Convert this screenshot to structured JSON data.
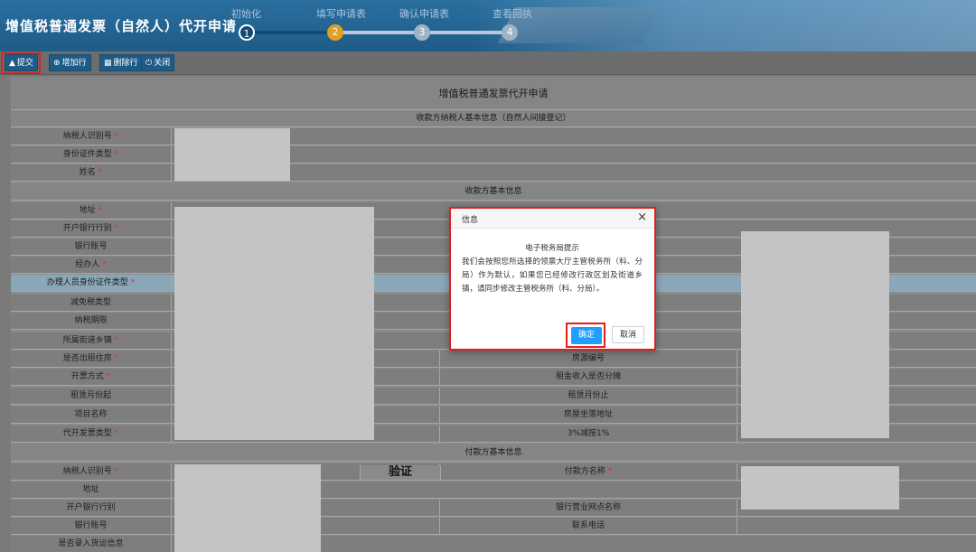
{
  "header": {
    "app_title": "增值税普通发票（自然人）代开申请",
    "steps": [
      {
        "label": "初始化",
        "number": "1"
      },
      {
        "label": "填写申请表",
        "number": "2"
      },
      {
        "label": "确认申请表",
        "number": "3"
      },
      {
        "label": "查看回执",
        "number": "4"
      }
    ],
    "active_step": 2
  },
  "toolbar": {
    "submit": "提交",
    "add_row": "增加行",
    "delete_row": "删除行",
    "close": "关闭"
  },
  "form": {
    "title": "增值税普通发票代开申请",
    "section_payee_taxpayer": "收款方纳税人基本信息（自然人间接登记）",
    "section_payee": "收款方基本信息",
    "section_payer": "付款方基本信息",
    "required_mark": "*",
    "rows": [
      {
        "label": "纳税人识别号",
        "required": true,
        "label2": ""
      },
      {
        "label": "身份证件类型",
        "required": true,
        "label2": ""
      },
      {
        "label": "姓名",
        "required": true,
        "label2": ""
      },
      {
        "label": "地址",
        "required": true,
        "label2": ""
      },
      {
        "label": "开户银行行别",
        "required": true,
        "label2": ""
      },
      {
        "label": "银行账号",
        "required": false,
        "label2": ""
      },
      {
        "label": "经办人",
        "required": true,
        "label2": ""
      },
      {
        "label": "办理人员身份证件类型",
        "required": true,
        "label2": ""
      },
      {
        "label": "减免税类型",
        "required": false,
        "label2": ""
      },
      {
        "label": "纳税期限",
        "required": false,
        "label2": ""
      },
      {
        "label": "所属街道乡镇",
        "required": true,
        "label2": ""
      },
      {
        "label": "是否出租住房",
        "required": true,
        "label2": "房源编号"
      },
      {
        "label": "开票方式",
        "required": true,
        "label2": "租金收入是否分摊"
      },
      {
        "label": "租赁月份起",
        "required": false,
        "label2": "租赁月份止"
      },
      {
        "label": "项目名称",
        "required": false,
        "label2": "房屋坐落地址"
      },
      {
        "label": "代开发票类型",
        "required": true,
        "label2": "3%减按1%"
      },
      {
        "label": "纳税人识别号",
        "required": true,
        "label2": "付款方名称"
      },
      {
        "label": "地址",
        "required": false,
        "label2": ""
      },
      {
        "label": "开户银行行别",
        "required": false,
        "label2": "银行营业网点名称"
      },
      {
        "label": "银行账号",
        "required": false,
        "label2": "联系电话"
      },
      {
        "label": "是否录入货运信息",
        "required": false,
        "label2": ""
      }
    ],
    "verify_label": "验证",
    "payer_name_required": true
  },
  "dialog": {
    "title": "信息",
    "close_symbol": "×",
    "heading": "电子税务局提示",
    "message": "我们会按照您所选择的领票大厅主管税务所（科、分局）作为默认，如果您已经修改行政区划及街道乡镇，请同步修改主管税务所（科、分局）。",
    "ok": "确定",
    "cancel": "取消"
  },
  "colors": {
    "header_bg": "#1f5b87",
    "active_step": "#e0a020",
    "done_step": "#144a73",
    "pending_step": "#9fb3c6",
    "highlight": "#e02020",
    "ok_button": "#1e9fff"
  },
  "icons": {
    "submit": "thumbs-up-icon",
    "add_row": "plus-circle-icon",
    "delete_row": "trash-icon",
    "close": "power-icon"
  }
}
